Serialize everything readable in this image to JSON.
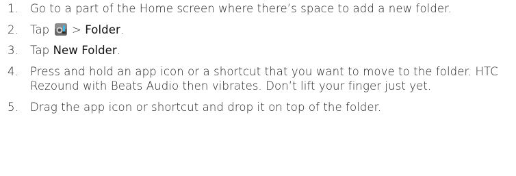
{
  "steps": [
    {
      "number": "1.",
      "text": "Go to a part of the Home screen where there’s space to add a new folder."
    },
    {
      "number": "2.",
      "prefix": "Tap",
      "icon": "personalize-icon",
      "separator": ">",
      "term": "Folder",
      "suffix": "."
    },
    {
      "number": "3.",
      "prefix": "Tap",
      "term": "New Folder",
      "suffix": "."
    },
    {
      "number": "4.",
      "text": "Press and hold an app icon or a shortcut that you want to move to the folder. HTC Rezound with Beats Audio then vibrates. Don’t lift your finger just yet."
    },
    {
      "number": "5.",
      "text": "Drag the app icon or shortcut and drop it on top of the folder."
    }
  ]
}
